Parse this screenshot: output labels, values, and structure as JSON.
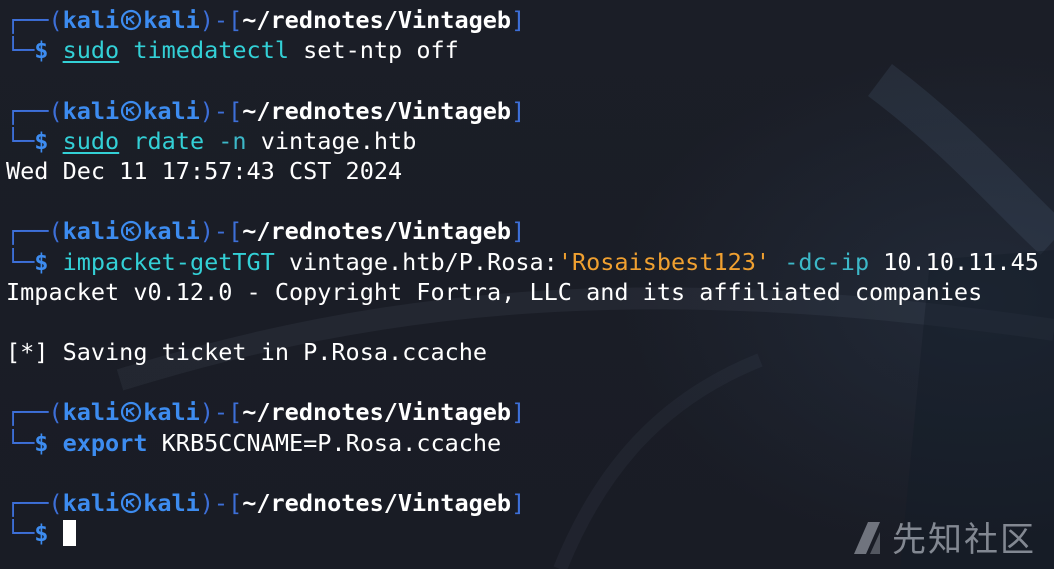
{
  "prompt": {
    "frame_top": "┌──(",
    "user": "kali",
    "host": "kali",
    "sep": ")-[",
    "path": "~/rednotes/Vintageb",
    "close": "]",
    "frame_bottom": "└─",
    "dollar": "$"
  },
  "blocks": [
    {
      "command": {
        "prefix": "sudo",
        "name": "timedatectl",
        "args": " set-ntp off"
      },
      "output": []
    },
    {
      "command": {
        "prefix": "sudo",
        "name": "rdate",
        "flag": "-n",
        "args": " vintage.htb"
      },
      "output": [
        "Wed Dec 11 17:57:43 CST 2024"
      ]
    },
    {
      "command": {
        "name": "impacket-getTGT",
        "args1": " vintage.htb/P.Rosa:",
        "string": "'Rosaisbest123'",
        "flag": "-dc-ip",
        "args2": " 10.10.11.45"
      },
      "output": [
        "Impacket v0.12.0 - Copyright Fortra, LLC and its affiliated companies",
        "",
        "[*] Saving ticket in P.Rosa.ccache"
      ]
    },
    {
      "command": {
        "name": "export",
        "args": " KRB5CCNAME=P.Rosa.ccache"
      },
      "output": []
    }
  ],
  "watermark": {
    "text": "先知社区"
  }
}
